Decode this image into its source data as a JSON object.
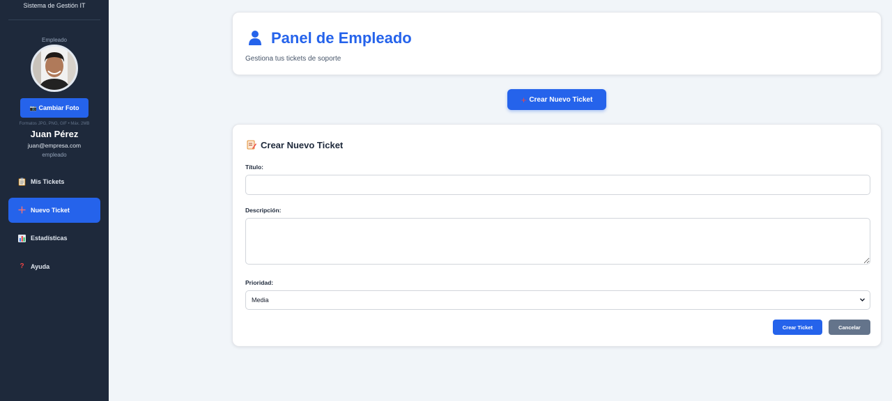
{
  "sidebar": {
    "system_title": "Sistema de Gestión IT",
    "role_label": "Empleado",
    "change_photo": "Cambiar Foto",
    "formats": "Formatos JPG, PNG, GIF • Máx. 2MB",
    "user_name": "Juan Pérez",
    "user_email": "juan@empresa.com",
    "user_role": "empleado",
    "nav": [
      {
        "label": "Mis Tickets",
        "icon": "clipboard-icon"
      },
      {
        "label": "Nuevo Ticket",
        "icon": "plus-icon",
        "active": true
      },
      {
        "label": "Estadísticas",
        "icon": "bar-chart-icon"
      },
      {
        "label": "Ayuda",
        "icon": "question-icon"
      }
    ]
  },
  "header": {
    "title": "Panel de Empleado",
    "subtitle": "Gestiona tus tickets de soporte"
  },
  "new_ticket_button": "Crear Nuevo Ticket",
  "form": {
    "title": "Crear Nuevo Ticket",
    "title_label": "Título:",
    "title_value": "",
    "description_label": "Descripción:",
    "description_value": "",
    "priority_label": "Prioridad:",
    "priority_value": "Media",
    "submit": "Crear Ticket",
    "cancel": "Cancelar"
  },
  "colors": {
    "sidebar_bg": "#1e293b",
    "accent": "#2563eb",
    "cancel": "#64748b"
  }
}
